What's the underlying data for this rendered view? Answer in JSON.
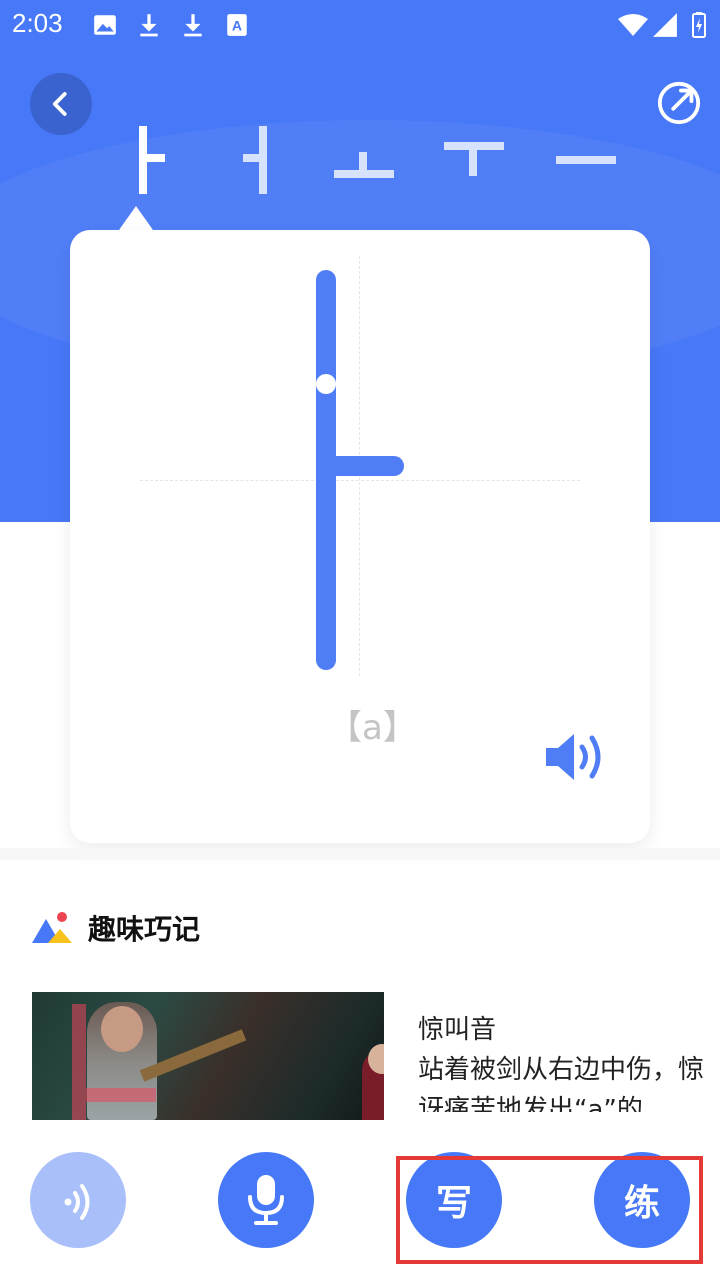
{
  "status_bar": {
    "time": "2:03",
    "icons": [
      "image-icon",
      "download-icon",
      "download-icon",
      "translate-icon",
      "wifi-icon",
      "signal-icon",
      "battery-icon"
    ]
  },
  "nav": {
    "back_icon": "arrow-left-icon",
    "share_icon": "share-icon"
  },
  "letter_tabs": [
    {
      "label": "ㅏ",
      "selected": true
    },
    {
      "label": "ㅓ",
      "selected": false
    },
    {
      "label": "ㅗ",
      "selected": false
    },
    {
      "label": "ㅜ",
      "selected": false
    },
    {
      "label": "ㅡ",
      "selected": false
    }
  ],
  "card": {
    "letter": "ㅏ",
    "romanization": "【a】",
    "speaker_icon": "speaker-icon"
  },
  "section": {
    "title": "趣味巧记",
    "description_title": "惊叫音",
    "description_line1": "站着被剑从右边中伤，惊",
    "description_line2": "讶痛苦地发出“a”的"
  },
  "bottom_bar": {
    "listen_icon": "sound-wave-icon",
    "mic_icon": "microphone-icon",
    "write_label": "写",
    "practice_label": "练"
  },
  "colors": {
    "primary": "#4778f7",
    "primary_light": "#a8bff9",
    "highlight": "#e53935"
  }
}
